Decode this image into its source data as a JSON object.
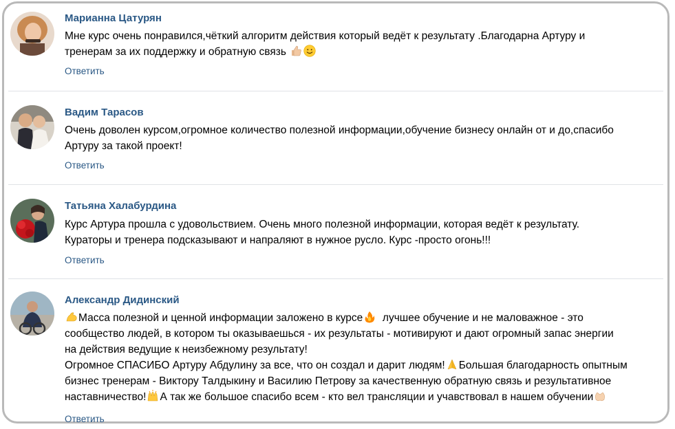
{
  "reply_label": "Ответить",
  "comments": [
    {
      "author": "Марианна Цатурян",
      "lines": [
        "Мне курс очень понравился,чёткий алгоритм действия который ведёт к результату .Благодарна Артуру и",
        "тренерам за их поддержку и обратную связь"
      ],
      "emojis": [
        "thumbs-up-icon",
        "smile-icon"
      ]
    },
    {
      "author": "Вадим Тарасов",
      "lines": [
        "Очень доволен курсом,огромное количество полезной информации,обучение бизнесу онлайн от и до,спасибо",
        "Артуру за такой проект!"
      ]
    },
    {
      "author": "Татьяна Халабурдина",
      "lines": [
        "Курс Артура прошла с удовольствием. Очень много полезной информации, которая ведёт к результату.",
        "Кураторы и тренера подсказывают и напраляют в нужное русло. Курс -просто огонь!!!"
      ]
    },
    {
      "author": "Александр Дидинский",
      "line1_a": "Масса полезной и ценной информации заложено в курсе",
      "line1_b": "  лучшее обучение и не маловажное - это",
      "line2": "сообщество людей, в котором ты оказываешься - их результаты - мотивируют и дают огромный запас энергии",
      "line3": "на действия ведущие к неизбежному результату!",
      "line4_a": "Огромное СПАСИБО Артуру Абдулину за все, что он создал и дарит людям!",
      "line4_b": "Большая благодарность опытным",
      "line5": "бизнес тренерам - Виктору Талдыкину и Василию Петрову за качественную обратную связь и результативное",
      "line6_a": "наставничество!",
      "line6_b": "А так же большое спасибо всем - кто вел трансляции и учавствовал в нашем обучении",
      "emojis": [
        "flexed-biceps-icon",
        "fire-icon",
        "praying-hands-icon",
        "raised-hands-icon",
        "clapping-hands-icon"
      ]
    }
  ],
  "colors": {
    "author": "#2a5885",
    "reply": "#2a5885",
    "text": "#000000",
    "divider": "#dfe2e6",
    "frame_border": "#b9b9b9"
  }
}
